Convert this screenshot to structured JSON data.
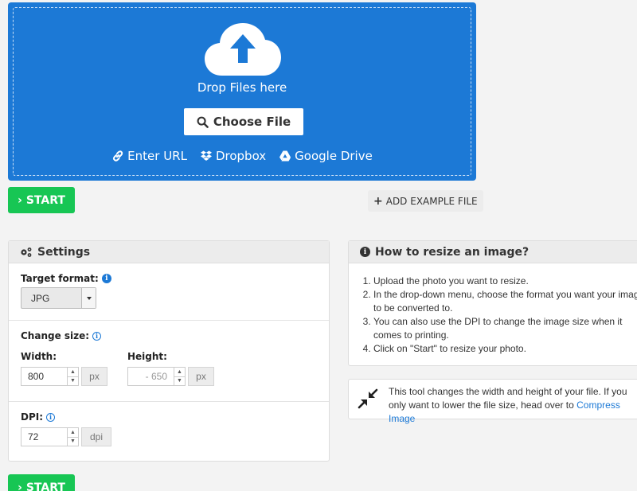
{
  "dropzone": {
    "drop_text": "Drop Files here",
    "choose_label": "Choose File",
    "sources": [
      {
        "label": "Enter URL",
        "icon": "link-icon"
      },
      {
        "label": "Dropbox",
        "icon": "dropbox-icon"
      },
      {
        "label": "Google Drive",
        "icon": "google-drive-icon"
      }
    ]
  },
  "actions": {
    "start_label": "START",
    "add_example_label": "ADD EXAMPLE FILE"
  },
  "settings": {
    "title": "Settings",
    "target_format_label": "Target format:",
    "target_format_value": "JPG",
    "change_size_label": "Change size:",
    "width_label": "Width:",
    "width_value": "800",
    "height_label": "Height:",
    "height_placeholder": "- 650",
    "unit": "px",
    "dpi_label": "DPI:",
    "dpi_value": "72",
    "dpi_unit": "dpi"
  },
  "howto": {
    "title": "How to resize an image?",
    "steps": [
      "Upload the photo you want to resize.",
      "In the drop-down menu, choose the format you want your images to be converted to.",
      "You can also use the DPI to change the image size when it comes to printing.",
      "Click on \"Start\" to resize your photo."
    ]
  },
  "tip": {
    "text": "This tool changes the width and height of your file. If you only want to lower the file size, head over to",
    "link": "Compress Image"
  },
  "colors": {
    "accent": "#1c79d6",
    "start_green": "#17c654"
  }
}
